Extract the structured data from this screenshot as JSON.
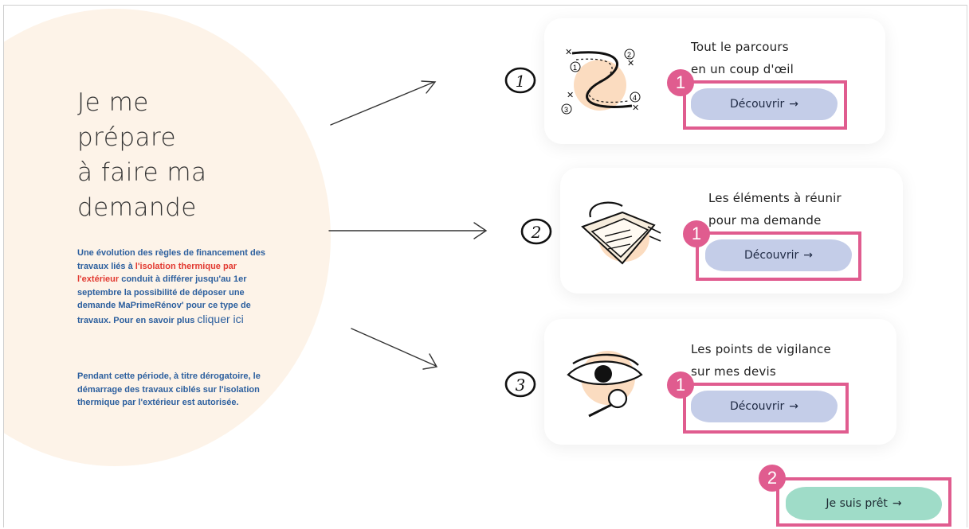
{
  "hero": {
    "title_lines": [
      "Je me",
      "prépare",
      "à faire ma",
      "demande"
    ]
  },
  "notice": {
    "p1_a": "Une évolution des règles de financement des travaux liés à",
    "p1_red": "l'isolation thermique par l'extérieur",
    "p1_b": "conduit à différer jusqu'au 1er septembre la possibilité de déposer une demande MaPrimeRénov' pour ce type de travaux. Pour en savoir plus",
    "link": "cliquer ici",
    "p2": "Pendant cette période, à titre dérogatoire, le démarrage des travaux ciblés sur l'isolation thermique par l'extérieur est autorisée."
  },
  "steps": [
    {
      "number": "1",
      "line1": "Tout le parcours",
      "line2": "en un coup d'œil",
      "button": "Découvrir",
      "illustration": "route-map-icon"
    },
    {
      "number": "2",
      "line1": "Les éléments à réunir",
      "line2": "pour ma demande",
      "button": "Découvrir",
      "illustration": "documents-icon"
    },
    {
      "number": "3",
      "line1": "Les points de vigilance",
      "line2": "sur mes devis",
      "button": "Découvrir",
      "illustration": "eye-magnifier-icon"
    }
  ],
  "cta": {
    "label": "Je suis prêt",
    "arrow": "→"
  },
  "annotations": {
    "step_marker": "1",
    "cta_marker": "2",
    "color": "#e05c8f"
  },
  "colors": {
    "accent_blue": "#2c5f9e",
    "button_blue": "#c4cde8",
    "button_green": "#9fdcc8",
    "warning_red": "#e23a31",
    "blob": "#fdf3e8"
  }
}
